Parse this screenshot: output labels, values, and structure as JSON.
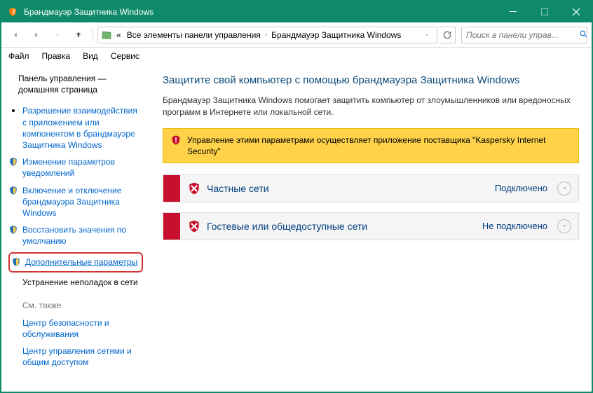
{
  "window": {
    "title": "Брандмауэр Защитника Windows"
  },
  "breadcrumb": {
    "prefix": "«",
    "item1": "Все элементы панели управления",
    "item2": "Брандмауэр Защитника Windows"
  },
  "search": {
    "placeholder": "Поиск в панели управ..."
  },
  "menu": {
    "file": "Файл",
    "edit": "Правка",
    "view": "Вид",
    "tools": "Сервис"
  },
  "sidebar": {
    "home": "Панель управления — домашняя страница",
    "items": [
      {
        "label": "Разрешение взаимодействия с приложением или компонентом в брандмауэре Защитника Windows",
        "icon": "bullet"
      },
      {
        "label": "Изменение параметров уведомлений",
        "icon": "shield"
      },
      {
        "label": "Включение и отключение брандмауэра Защитника Windows",
        "icon": "shield"
      },
      {
        "label": "Восстановить значения по умолчанию",
        "icon": "shield"
      },
      {
        "label": "Дополнительные параметры",
        "icon": "shield",
        "highlight": true
      }
    ],
    "plain": "Устранение неполадок в сети",
    "see_also": "См. также",
    "links": [
      "Центр безопасности и обслуживания",
      "Центр управления сетями и общим доступом"
    ]
  },
  "main": {
    "heading": "Защитите свой компьютер с помощью брандмауэра Защитника Windows",
    "desc": "Брандмауэр Защитника Windows помогает защитить компьютер от злоумышленников или вредоносных программ в Интернете или локальной сети.",
    "banner": "Управление этими параметрами осуществляет приложение поставщика \"Kaspersky Internet Security\"",
    "networks": [
      {
        "title": "Частные сети",
        "status": "Подключено"
      },
      {
        "title": "Гостевые или общедоступные сети",
        "status": "Не подключено"
      }
    ]
  }
}
